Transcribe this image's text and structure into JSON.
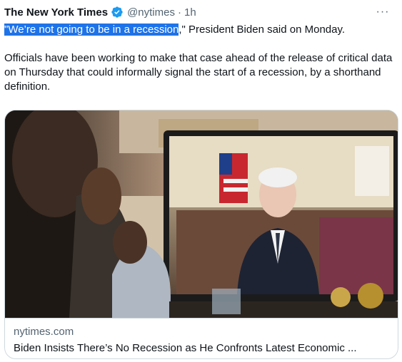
{
  "tweet": {
    "author_name": "The New York Times",
    "handle": "@nytimes",
    "separator": "·",
    "time": "1h",
    "more_label": "···",
    "highlighted_quote": "\"We’re not going to be in a recession",
    "quote_rest": ",\" President Biden said on Monday.",
    "paragraph2": "Officials have been working to make that case ahead of the release of critical data on Thursday that could informally signal the start of a recession, by a shorthand definition."
  },
  "card": {
    "domain": "nytimes.com",
    "title": "Biden Insists There’s No Recession as He Confronts Latest Economic ...",
    "image_icon": "photo-biden-video-call"
  },
  "colors": {
    "verified_badge": "#1d9bf0",
    "selection_highlight": "#1e73e8",
    "secondary_text": "#536471",
    "border": "#cfd9de"
  }
}
